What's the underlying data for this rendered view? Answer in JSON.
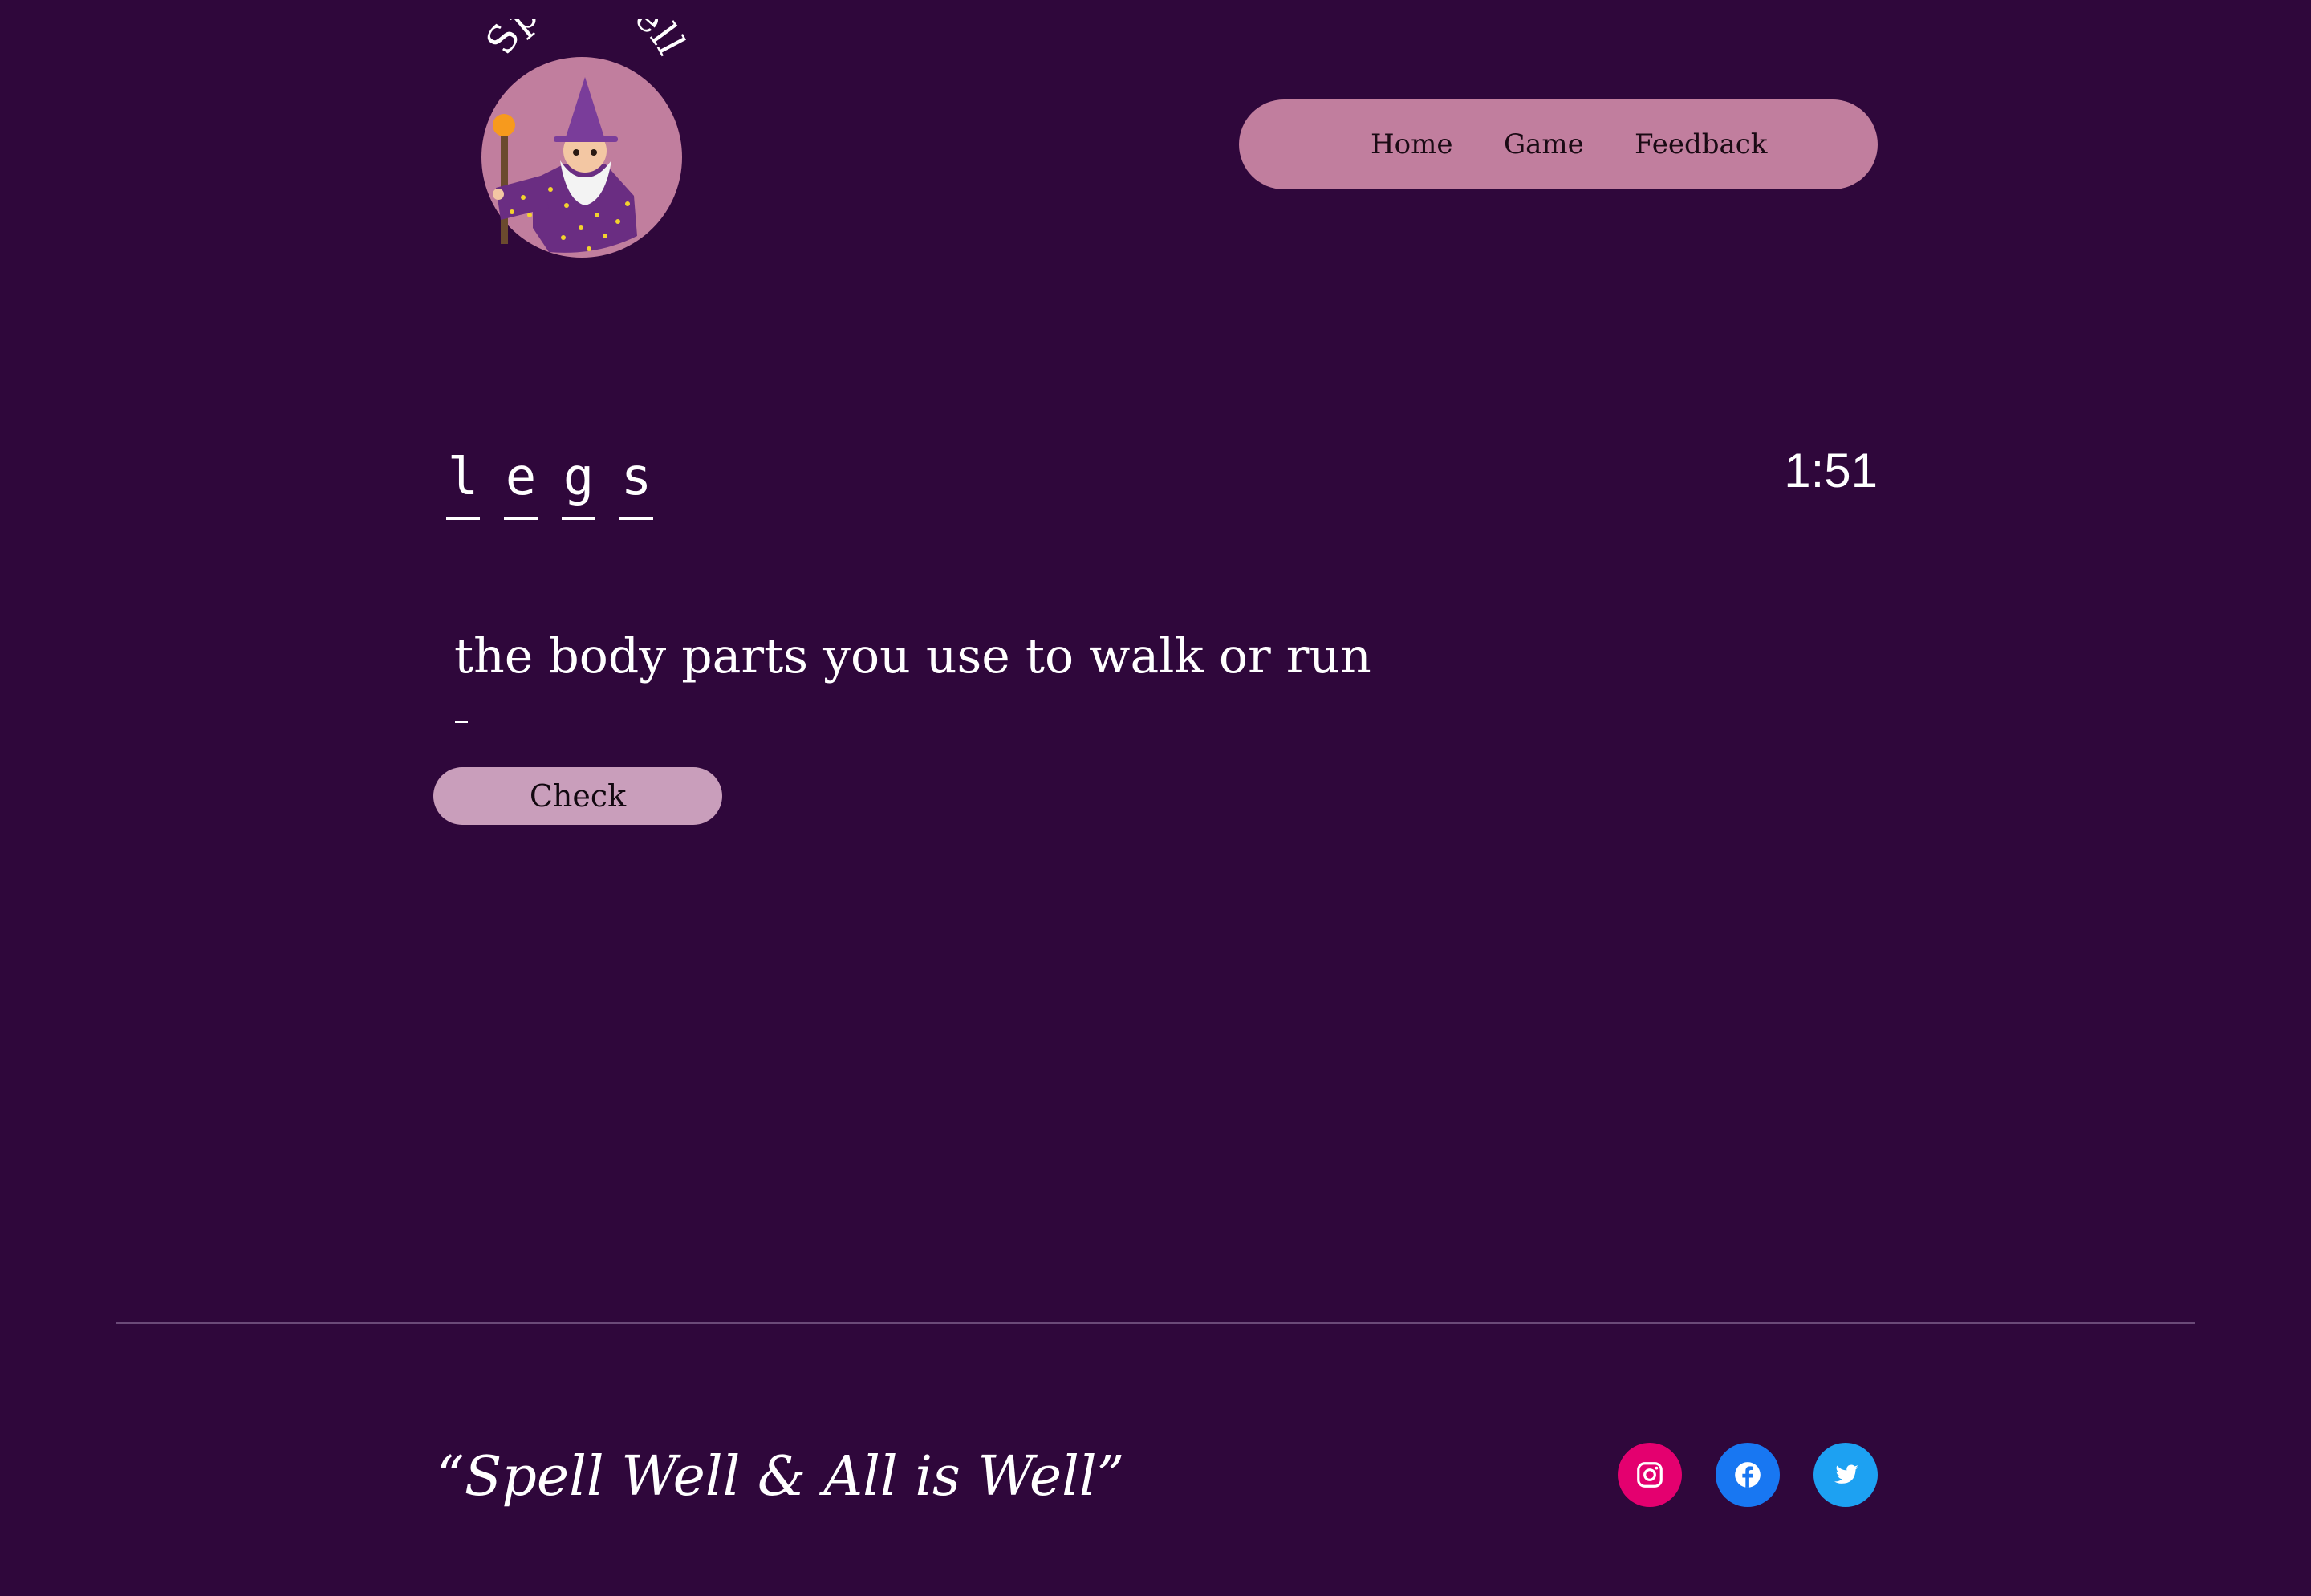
{
  "logo": {
    "text": "Spell Well",
    "icon": "wizard-icon"
  },
  "nav": {
    "items": [
      {
        "label": "Home"
      },
      {
        "label": "Game"
      },
      {
        "label": "Feedback"
      }
    ]
  },
  "game": {
    "letters": [
      "l",
      "e",
      "g",
      "s"
    ],
    "timer": "1:51",
    "hint": "the body parts you use to walk or run",
    "answer_value": "",
    "check_label": "Check"
  },
  "footer": {
    "tagline": "“Spell Well & All is Well”",
    "social": [
      {
        "name": "instagram",
        "icon": "instagram-icon",
        "color": "#e4006f"
      },
      {
        "name": "facebook",
        "icon": "facebook-icon",
        "color": "#1877f2"
      },
      {
        "name": "twitter",
        "icon": "twitter-icon",
        "color": "#1da1f2"
      }
    ]
  },
  "colors": {
    "background": "#2f073b",
    "nav_background": "#c17e9e",
    "button_background": "#c99ebb",
    "text": "#ffffff"
  }
}
